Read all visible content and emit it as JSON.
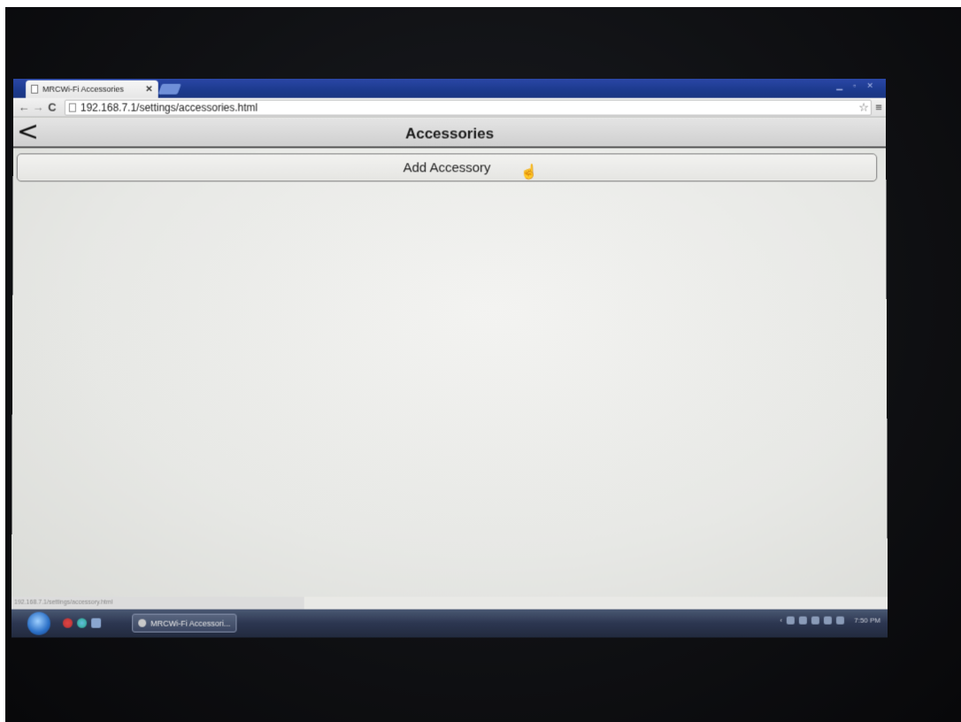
{
  "browser": {
    "tab_title": "MRCWi-Fi Accessories",
    "tab_close": "✕",
    "url": "192.168.7.1/settings/accessories.html",
    "status_url": "192.168.7.1/settings/accessory.html"
  },
  "page": {
    "title": "Accessories",
    "back_glyph": "<",
    "add_button_label": "Add Accessory"
  },
  "taskbar": {
    "task_label": "MRCWi-Fi Accessori...",
    "clock": "7:50 PM"
  },
  "icons": {
    "back": "back-arrow-icon",
    "forward": "forward-arrow-icon",
    "reload": "reload-icon",
    "bookmark": "star-icon",
    "menu": "hamburger-menu-icon",
    "cursor": "hand-cursor-icon",
    "start": "windows-start-orb-icon"
  }
}
